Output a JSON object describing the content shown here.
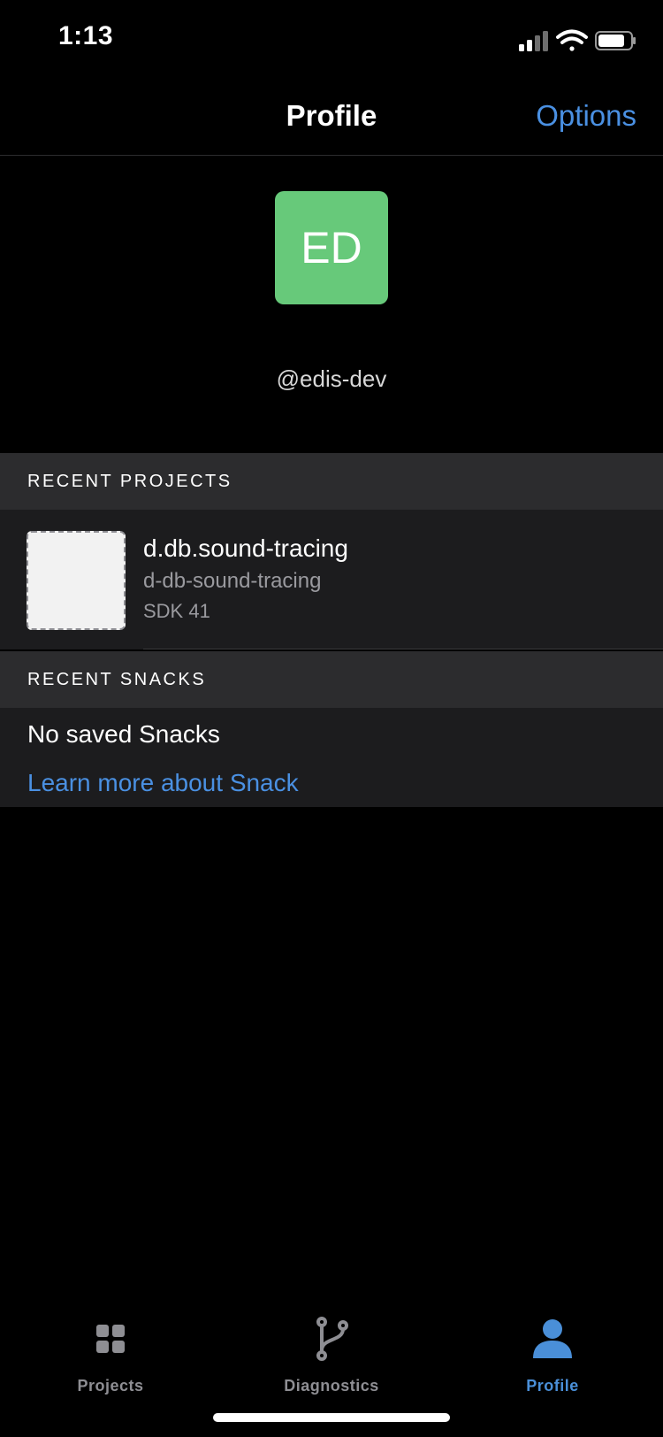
{
  "status_bar": {
    "time": "1:13",
    "icons": [
      "cellular-signal-icon",
      "wifi-icon",
      "battery-icon"
    ]
  },
  "nav": {
    "title": "Profile",
    "options_label": "Options"
  },
  "profile": {
    "avatar_initials": "ED",
    "avatar_color": "#67c97a",
    "username": "@edis-dev"
  },
  "recent_projects": {
    "header": "RECENT PROJECTS",
    "items": [
      {
        "name": "d.db.sound-tracing",
        "slug": "d-db-sound-tracing",
        "sdk": "SDK 41"
      }
    ]
  },
  "recent_snacks": {
    "header": "RECENT SNACKS",
    "empty_text": "No saved Snacks",
    "learn_more_label": "Learn more about Snack"
  },
  "tab_bar": {
    "tabs": [
      {
        "label": "Projects",
        "icon": "grid-icon",
        "active": false
      },
      {
        "label": "Diagnostics",
        "icon": "branch-icon",
        "active": false
      },
      {
        "label": "Profile",
        "icon": "person-icon",
        "active": true
      }
    ]
  },
  "colors": {
    "accent": "#4a90e2",
    "background": "#000000",
    "section_header": "#2c2c2e",
    "row_background": "#1c1c1e"
  }
}
